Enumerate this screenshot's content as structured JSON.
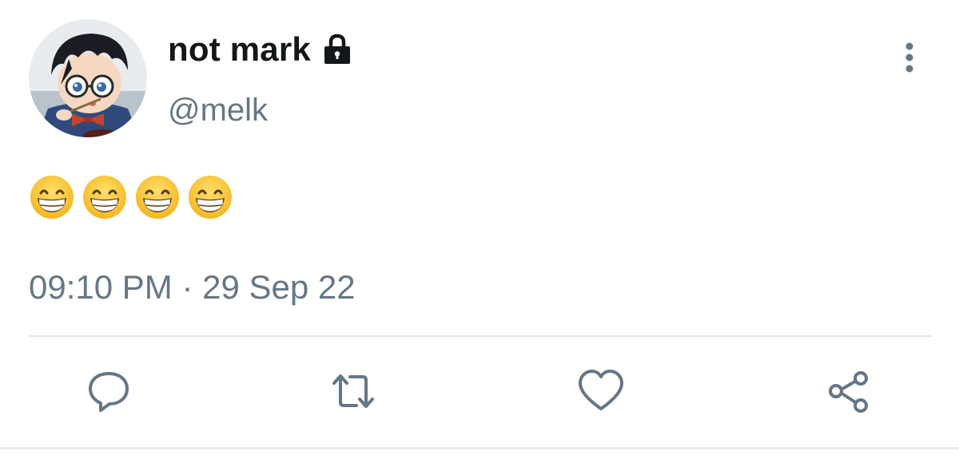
{
  "tweet": {
    "author": {
      "display_name": "not mark",
      "handle": "@melk",
      "protected": true,
      "avatar_icon": "anime-character-avatar"
    },
    "content": {
      "emojis": [
        "grinning-face-emoji",
        "grinning-face-emoji",
        "grinning-face-emoji",
        "grinning-face-emoji"
      ]
    },
    "timestamp": "09:10 PM · 29 Sep 22"
  },
  "actions": {
    "more": "more-options-icon",
    "reply": "reply-icon",
    "retweet": "retweet-icon",
    "like": "heart-icon",
    "share": "share-icon"
  },
  "colors": {
    "primary_text": "#14171a",
    "secondary_text": "#657786",
    "divider": "#e1e8ed",
    "emoji_face": "#f7c531"
  }
}
